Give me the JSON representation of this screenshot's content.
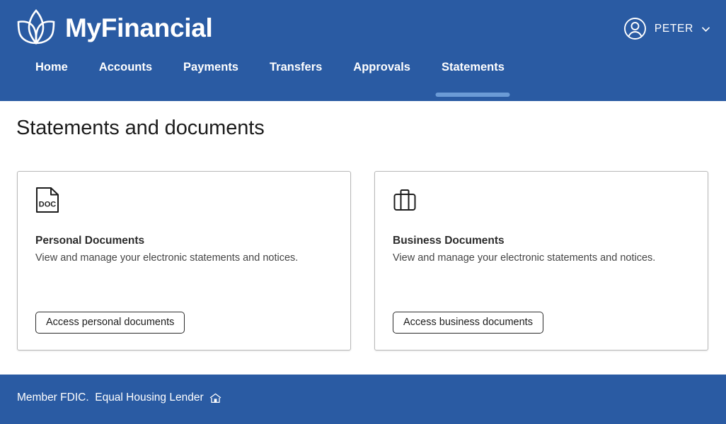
{
  "header": {
    "brand_name": "MyFinancial",
    "logo_icon": "lotus-icon",
    "user": {
      "avatar_icon": "user-avatar-icon",
      "name": "PETER",
      "chevron_icon": "chevron-down-icon"
    },
    "nav_items": [
      {
        "label": "Home",
        "active": false
      },
      {
        "label": "Accounts",
        "active": false
      },
      {
        "label": "Payments",
        "active": false
      },
      {
        "label": "Transfers",
        "active": false
      },
      {
        "label": "Approvals",
        "active": false
      },
      {
        "label": "Statements",
        "active": true
      }
    ]
  },
  "main": {
    "page_title": "Statements and documents",
    "cards": [
      {
        "icon": "document-doc-icon",
        "title": "Personal Documents",
        "description": "View and manage your electronic statements and notices.",
        "button_label": "Access personal documents"
      },
      {
        "icon": "briefcase-icon",
        "title": "Business Documents",
        "description": "View and manage your electronic statements and notices.",
        "button_label": "Access business documents"
      }
    ]
  },
  "footer": {
    "text": "Member FDIC.  Equal Housing Lender",
    "icon": "equal-housing-lender-house-icon"
  },
  "colors": {
    "brand_blue": "#2a5ba3",
    "active_tab_indicator": "#6b9bd6",
    "card_border": "#b9b9b9",
    "text_primary": "#1c1c1c"
  }
}
